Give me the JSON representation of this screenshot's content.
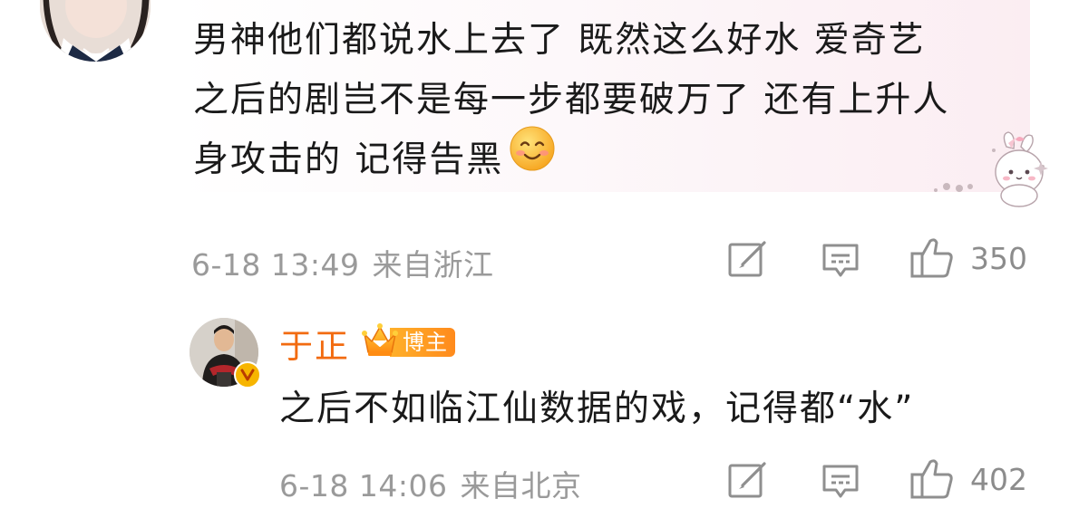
{
  "comment": {
    "lines": [
      "男神他们都说水上去了 既然这么好水 爱奇艺",
      "之后的剧岂不是每一步都要破万了 还有上升人",
      "身攻击的 记得告黑"
    ],
    "emoji": "smile-emoji",
    "time": "6-18 13:49",
    "location": "来自浙江",
    "likes": "350"
  },
  "reply": {
    "username": "于正",
    "badge": "博主",
    "text": "之后不如临江仙数据的戏，记得都“水”",
    "time": "6-18 14:06",
    "location": "来自北京",
    "likes": "402"
  },
  "colors": {
    "username": "#f26b10",
    "meta": "#9a9a9a",
    "badge": "#ff9a22",
    "verified": "#f7b500",
    "bubble_tint": "#fbedf2"
  }
}
